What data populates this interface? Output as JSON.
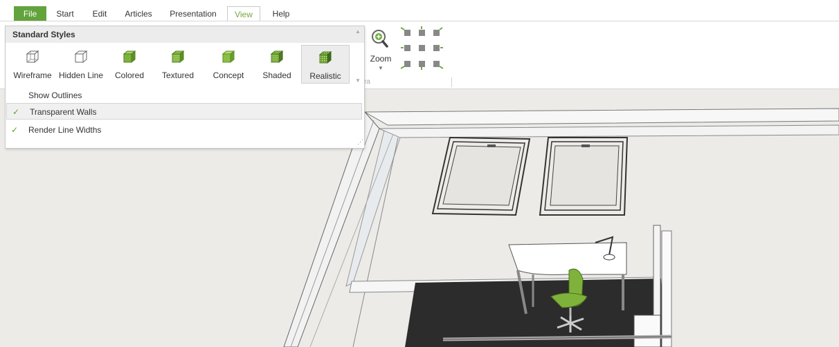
{
  "menu": {
    "tabs": [
      "File",
      "Start",
      "Edit",
      "Articles",
      "Presentation",
      "View",
      "Help"
    ],
    "active": "View"
  },
  "ribbon": {
    "zoom_label": "Zoom",
    "group_label_fragment": "ra"
  },
  "styles_menu": {
    "header": "Standard Styles",
    "styles": [
      {
        "label": "Wireframe",
        "icon": "wireframe-cube-icon"
      },
      {
        "label": "Hidden Line",
        "icon": "hidden-line-cube-icon"
      },
      {
        "label": "Colored",
        "icon": "colored-cube-icon"
      },
      {
        "label": "Textured",
        "icon": "textured-cube-icon"
      },
      {
        "label": "Concept",
        "icon": "concept-cube-icon"
      },
      {
        "label": "Shaded",
        "icon": "shaded-cube-icon"
      },
      {
        "label": "Realistic",
        "icon": "realistic-cube-icon"
      }
    ],
    "selected_style": "Realistic",
    "options": [
      {
        "label": "Show Outlines",
        "checked": false
      },
      {
        "label": "Transparent Walls",
        "checked": true
      },
      {
        "label": "Render Line Widths",
        "checked": true
      }
    ]
  },
  "colors": {
    "accent": "#63a33c",
    "check": "#5aa02c",
    "chair": "#7fb23a",
    "floor": "#2c2c2c",
    "viewport_bg": "#edebe8"
  }
}
